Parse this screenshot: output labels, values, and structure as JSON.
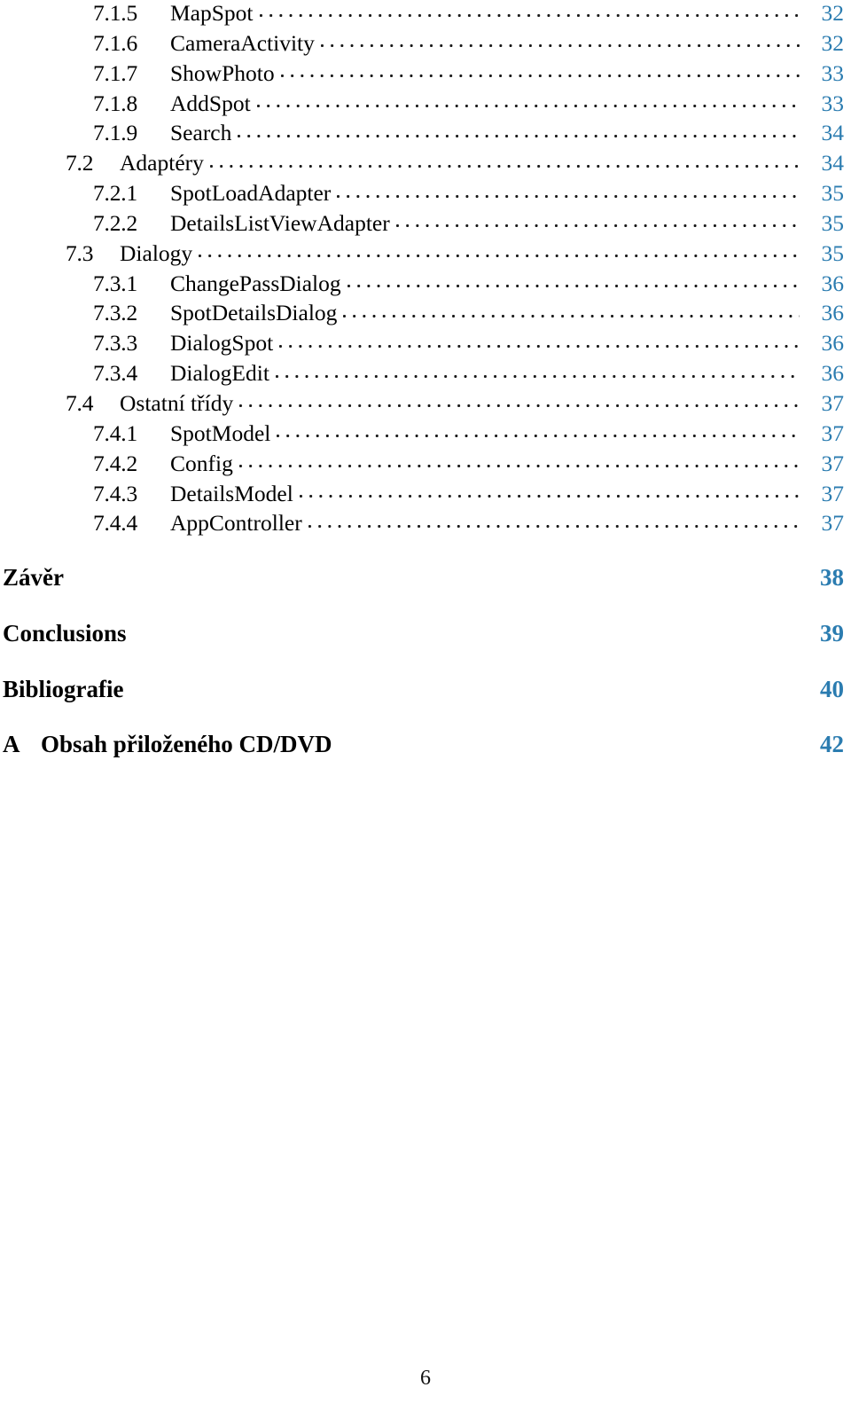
{
  "document": {
    "kind": "table-of-contents",
    "language": "cs",
    "folio": "6",
    "accent_color": "#2b7cb0",
    "text_color": "#000000"
  },
  "toc": {
    "entries": [
      {
        "number": "7.1.5",
        "title": "MapSpot",
        "page": "32",
        "level": "sub"
      },
      {
        "number": "7.1.6",
        "title": "CameraActivity",
        "page": "32",
        "level": "sub"
      },
      {
        "number": "7.1.7",
        "title": "ShowPhoto",
        "page": "33",
        "level": "sub"
      },
      {
        "number": "7.1.8",
        "title": "AddSpot",
        "page": "33",
        "level": "sub"
      },
      {
        "number": "7.1.9",
        "title": "Search",
        "page": "34",
        "level": "sub"
      },
      {
        "number": "7.2",
        "title": "Adaptéry",
        "page": "34",
        "level": "sec"
      },
      {
        "number": "7.2.1",
        "title": "SpotLoadAdapter",
        "page": "35",
        "level": "sub"
      },
      {
        "number": "7.2.2",
        "title": "DetailsListViewAdapter",
        "page": "35",
        "level": "sub"
      },
      {
        "number": "7.3",
        "title": "Dialogy",
        "page": "35",
        "level": "sec"
      },
      {
        "number": "7.3.1",
        "title": "ChangePassDialog",
        "page": "36",
        "level": "sub"
      },
      {
        "number": "7.3.2",
        "title": "SpotDetailsDialog",
        "page": "36",
        "level": "sub"
      },
      {
        "number": "7.3.3",
        "title": "DialogSpot",
        "page": "36",
        "level": "sub"
      },
      {
        "number": "7.3.4",
        "title": "DialogEdit",
        "page": "36",
        "level": "sub"
      },
      {
        "number": "7.4",
        "title": "Ostatní třídy",
        "page": "37",
        "level": "sec"
      },
      {
        "number": "7.4.1",
        "title": "SpotModel",
        "page": "37",
        "level": "sub"
      },
      {
        "number": "7.4.2",
        "title": "Config",
        "page": "37",
        "level": "sub"
      },
      {
        "number": "7.4.3",
        "title": "DetailsModel",
        "page": "37",
        "level": "sub"
      },
      {
        "number": "7.4.4",
        "title": "AppController",
        "page": "37",
        "level": "sub"
      }
    ],
    "chapters": [
      {
        "number": "",
        "title": "Závěr",
        "page": "38"
      },
      {
        "number": "",
        "title": "Conclusions",
        "page": "39"
      },
      {
        "number": "",
        "title": "Bibliografie",
        "page": "40"
      },
      {
        "number": "A",
        "title": "Obsah přiloženého CD/DVD",
        "page": "42"
      }
    ]
  }
}
